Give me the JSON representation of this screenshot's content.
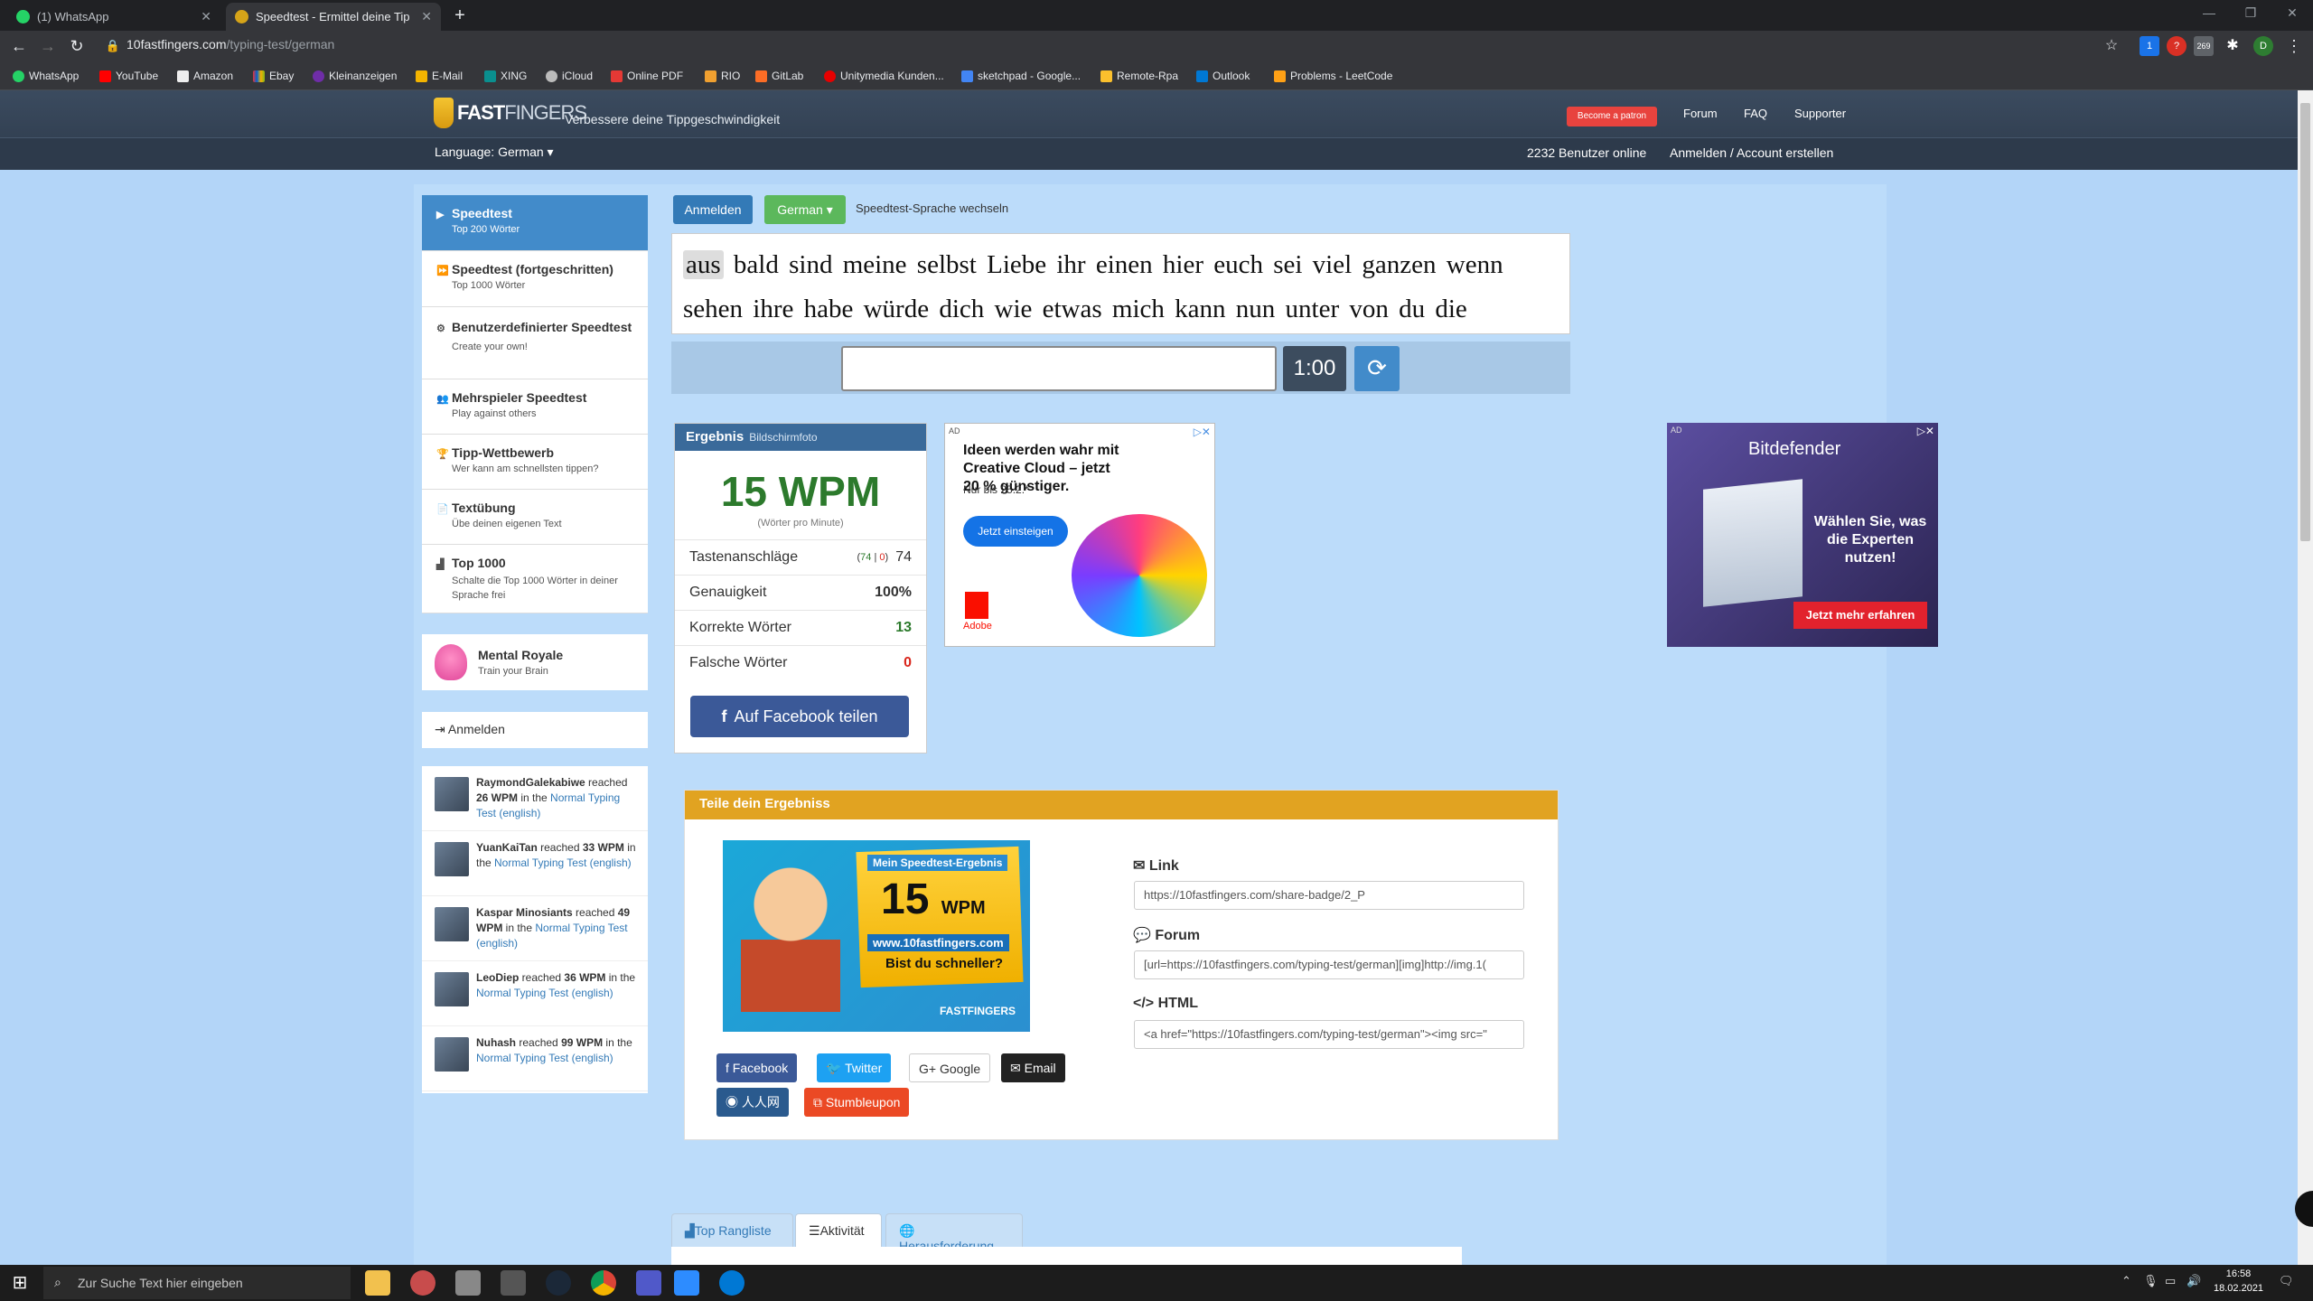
{
  "browser": {
    "tabs": [
      {
        "title": "(1) WhatsApp",
        "active": false
      },
      {
        "title": "Speedtest - Ermittel deine Tippg",
        "active": true
      }
    ],
    "url_host": "10fastfingers.com",
    "url_path": "/typing-test/german",
    "bookmarks": [
      "WhatsApp",
      "YouTube",
      "Amazon",
      "Ebay",
      "Kleinanzeigen",
      "E-Mail",
      "XING",
      "iCloud",
      "Online PDF",
      "RIO",
      "GitLab",
      "Unitymedia Kunden...",
      "sketchpad - Google...",
      "Remote-Rpa",
      "Outlook",
      "Problems - LeetCode"
    ],
    "extension_badges": [
      "1",
      "269",
      "D"
    ]
  },
  "site": {
    "logo_text_bold": "FAST",
    "logo_text_rest": "FINGERS",
    "tagline": "Verbessere deine Tippgeschwindigkeit",
    "patron": "Become a patron",
    "nav": [
      "Forum",
      "FAQ",
      "Supporter"
    ],
    "language_label": "Language: German",
    "online": "2232 Benutzer online",
    "account": "Anmelden / Account erstellen"
  },
  "sidebar": {
    "items": [
      {
        "title": "Speedtest",
        "sub": "Top 200 Wörter",
        "icon": "play-icon"
      },
      {
        "title": "Speedtest (fortgeschritten)",
        "sub": "Top 1000 Wörter",
        "icon": "fast-forward-icon"
      },
      {
        "title": "Benutzerdefinierter Speedtest",
        "sub": "Create your own!",
        "icon": "cogs-icon"
      },
      {
        "title": "Mehrspieler Speedtest",
        "sub": "Play against others",
        "icon": "users-icon"
      },
      {
        "title": "Tipp-Wettbewerb",
        "sub": "Wer kann am schnellsten tippen?",
        "icon": "trophy-icon"
      },
      {
        "title": "Textübung",
        "sub": "Übe deinen eigenen Text",
        "icon": "file-icon"
      },
      {
        "title": "Top 1000",
        "sub": "Schalte die Top 1000 Wörter in deiner Sprache frei",
        "icon": "signal-icon"
      }
    ],
    "mental_title": "Mental Royale",
    "mental_sub": "Train your Brain",
    "login": "Anmelden",
    "feed": [
      {
        "user": "RaymondGalekabiwe",
        "pre": " reached ",
        "wpm": "26 WPM",
        "mid": " in the ",
        "test": "Normal Typing Test (english)"
      },
      {
        "user": "YuanKaiTan",
        "pre": " reached ",
        "wpm": "33 WPM",
        "mid": " in the ",
        "test": "Normal Typing Test (english)"
      },
      {
        "user": "Kaspar Minosiants",
        "pre": " reached ",
        "wpm": "49 WPM",
        "mid": " in the ",
        "test": "Normal Typing Test (english)"
      },
      {
        "user": "LeoDiep",
        "pre": " reached ",
        "wpm": "36 WPM",
        "mid": " in the ",
        "test": "Normal Typing Test (english)"
      },
      {
        "user": "Nuhash",
        "pre": " reached ",
        "wpm": "99 WPM",
        "mid": " in the ",
        "test": "Normal Typing Test (english)"
      }
    ]
  },
  "test": {
    "login_button": "Anmelden",
    "language_button": "German",
    "language_switch": "Speedtest-Sprache wechseln",
    "current_word": "aus",
    "line1_rest": "bald sind meine selbst Liebe ihr einen hier euch sei viel ganzen wenn",
    "line2": "sehen ihre habe würde dich wie etwas mich kann nun unter von du die",
    "input_value": "",
    "timer": "1:00"
  },
  "result": {
    "title": "Ergebnis",
    "screenshot_link": "Bildschirmfoto",
    "wpm": "15 WPM",
    "wpm_sub": "(Wörter pro Minute)",
    "rows": [
      {
        "label": "Tastenanschläge",
        "detail_ok": "74",
        "detail_bad": "0",
        "value": "74",
        "color": "#333333"
      },
      {
        "label": "Genauigkeit",
        "value": "100%",
        "color": "#333333"
      },
      {
        "label": "Korrekte Wörter",
        "value": "13",
        "color": "#2c7a2c"
      },
      {
        "label": "Falsche Wörter",
        "value": "0",
        "color": "#d9261c"
      }
    ],
    "facebook_share": "Auf Facebook teilen"
  },
  "ads": {
    "ad_label": "AD",
    "adobe_title": "Ideen werden wahr mit Creative Cloud – jetzt 20 % günstiger.",
    "adobe_sub": "Nur bis 25.2.*",
    "adobe_cta": "Jetzt einsteigen",
    "adobe_brand": "Adobe",
    "bd_brand": "Bitdefender",
    "bd_text": "Wählen Sie, was die Experten nutzen!",
    "bd_cta": "Jetzt mehr erfahren"
  },
  "share": {
    "title": "Teile dein Ergebniss",
    "badge_l1": "Mein Speedtest-Ergebnis",
    "badge_wpm": "15",
    "badge_unit": "WPM",
    "badge_site": "www.10fastfingers.com",
    "badge_q": "Bist du schneller?",
    "badge_logo": "FASTFINGERS",
    "buttons": [
      {
        "label": "Facebook",
        "color": "#3b5998"
      },
      {
        "label": "Twitter",
        "color": "#1da1f2"
      },
      {
        "label": "Google",
        "color": "#ffffff"
      },
      {
        "label": "Email",
        "color": "#222222"
      },
      {
        "label": "人人网",
        "color": "#2a5a8e"
      },
      {
        "label": "Stumbleupon",
        "color": "#eb4924"
      }
    ],
    "link_label": "Link",
    "link_value": "https://10fastfingers.com/share-badge/2_P",
    "forum_label": "Forum",
    "forum_value": "[url=https://10fastfingers.com/typing-test/german][img]http://img.1(",
    "html_label": "HTML",
    "html_value": "<a href=\"https://10fastfingers.com/typing-test/german\"><img src=\""
  },
  "bottom_tabs": [
    "Top Rangliste",
    "Aktivität",
    "Herausforderung"
  ],
  "taskbar": {
    "search_placeholder": "Zur Suche Text hier eingeben",
    "time": "16:58",
    "date": "18.02.2021"
  }
}
